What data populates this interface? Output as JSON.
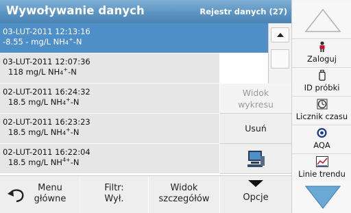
{
  "header": {
    "title": "Wywoływanie danych",
    "subtitle": "Rejestr danych (27)"
  },
  "rows": [
    {
      "datetime": "03-LUT-2011  12:13:16",
      "value": "-8.55  -  mg/L",
      "unit": "NH",
      "sub": "4",
      "sup": "+",
      "suffix": "-N",
      "selected": true
    },
    {
      "datetime": "03-LUT-2011  12:07:36",
      "value": "118  mg/L",
      "unit": "NH",
      "sub": "4",
      "sup": "+",
      "suffix": "-N",
      "selected": false
    },
    {
      "datetime": "02-LUT-2011  16:24:32",
      "value": "18.5  mg/L",
      "unit": "NH",
      "sub": "4",
      "sup": "+",
      "suffix": "-N",
      "selected": false
    },
    {
      "datetime": "02-LUT-2011  16:23:23",
      "value": "18.5  mg/L",
      "unit": "NH",
      "sub": "4",
      "sup": "+",
      "suffix": "-N",
      "selected": false
    },
    {
      "datetime": "02-LUT-2011  16:22:04",
      "value": "18.5  mg/L",
      "unit": "NH",
      "sub": "4+",
      "sup": "",
      "suffix": "-N",
      "selected": false
    }
  ],
  "mid": {
    "chart_view_line1": "Widok",
    "chart_view_line2": "wykresu",
    "delete": "Usuń"
  },
  "bottom": {
    "menu_line1": "Menu",
    "menu_line2": "główne",
    "filter_line1": "Filtr:",
    "filter_line2": "Wył.",
    "detail_line1": "Widok",
    "detail_line2": "szczegółów",
    "options": "Opcje"
  },
  "sidebar": {
    "login": "Zaloguj",
    "sample_id": "ID próbki",
    "timer": "Licznik czasu",
    "aqa": "AQA",
    "trend": "Linie trendu"
  },
  "icons": {
    "scroll_up": "triangle-up",
    "side_up": "triangle-up",
    "side_down": "triangle-down",
    "login": "person",
    "sample_id": "bottle",
    "timer": "clock",
    "aqa": "target",
    "trend": "line-chart",
    "computer": "computer",
    "back": "curved-arrow"
  },
  "colors": {
    "header": "#5c94c2",
    "selected": "#4f8fc7",
    "triangle": "#6aa9d6"
  }
}
